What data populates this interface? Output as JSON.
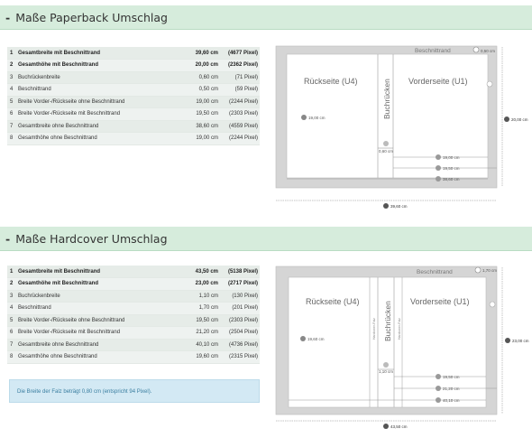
{
  "paperback": {
    "title": "Maße Paperback Umschlag",
    "rows": [
      {
        "n": "1",
        "label": "Gesamtbreite mit Beschnittrand",
        "cm": "39,60 cm",
        "px": "(4677 Pixel)",
        "bold": true
      },
      {
        "n": "2",
        "label": "Gesamthöhe mit Beschnittrand",
        "cm": "20,00 cm",
        "px": "(2362 Pixel)",
        "bold": true
      },
      {
        "n": "3",
        "label": "Buchrückenbreite",
        "cm": "0,60 cm",
        "px": "(71 Pixel)"
      },
      {
        "n": "4",
        "label": "Beschnittrand",
        "cm": "0,50 cm",
        "px": "(59 Pixel)"
      },
      {
        "n": "5",
        "label": "Breite Vorder-/Rückseite ohne Beschnittrand",
        "cm": "19,00 cm",
        "px": "(2244 Pixel)"
      },
      {
        "n": "6",
        "label": "Breite Vorder-/Rückseite mit Beschnittrand",
        "cm": "19,50 cm",
        "px": "(2303 Pixel)"
      },
      {
        "n": "7",
        "label": "Gesamtbreite ohne Beschnittrand",
        "cm": "38,60 cm",
        "px": "(4559 Pixel)"
      },
      {
        "n": "8",
        "label": "Gesamthöhe ohne Beschnittrand",
        "cm": "19,00 cm",
        "px": "(2244 Pixel)"
      }
    ],
    "diagram": {
      "bleed_label": "Beschnittrand",
      "back": "Rückseite (U4)",
      "spine": "Buchrücken",
      "front": "Vorderseite (U1)",
      "bleed_dim": "0,50 cm",
      "height_dim": "20,00 cm",
      "back_height": "19,00 cm",
      "spine_dim": "0,60 cm",
      "front_width": "19,00 cm",
      "front_width_bleed": "19,50 cm",
      "total_no_bleed": "38,60 cm",
      "total_width": "39,60 cm"
    }
  },
  "hardcover": {
    "title": "Maße Hardcover Umschlag",
    "rows": [
      {
        "n": "1",
        "label": "Gesamtbreite mit Beschnittrand",
        "cm": "43,50 cm",
        "px": "(5138 Pixel)",
        "bold": true
      },
      {
        "n": "2",
        "label": "Gesamthöhe mit Beschnittrand",
        "cm": "23,00 cm",
        "px": "(2717 Pixel)",
        "bold": true
      },
      {
        "n": "3",
        "label": "Buchrückenbreite",
        "cm": "1,10 cm",
        "px": "(130 Pixel)"
      },
      {
        "n": "4",
        "label": "Beschnittrand",
        "cm": "1,70 cm",
        "px": "(201 Pixel)"
      },
      {
        "n": "5",
        "label": "Breite Vorder-/Rückseite ohne Beschnittrand",
        "cm": "19,50 cm",
        "px": "(2303 Pixel)"
      },
      {
        "n": "6",
        "label": "Breite Vorder-/Rückseite mit Beschnittrand",
        "cm": "21,20 cm",
        "px": "(2504 Pixel)"
      },
      {
        "n": "7",
        "label": "Gesamtbreite ohne Beschnittrand",
        "cm": "40,10 cm",
        "px": "(4736 Pixel)"
      },
      {
        "n": "8",
        "label": "Gesamthöhe ohne Beschnittrand",
        "cm": "19,60 cm",
        "px": "(2315 Pixel)"
      }
    ],
    "note": "Die Breite der Falz beträgt 0,80 cm (entspricht 94 Pixel).",
    "diagram": {
      "bleed_label": "Beschnittrand",
      "back": "Rückseite (U4)",
      "spine": "Buchrücken",
      "front": "Vorderseite (U1)",
      "fold": "Hardcover-Falz",
      "bleed_dim": "1,70 cm",
      "height_dim": "23,00 cm",
      "back_height": "19,60 cm",
      "spine_dim": "1,10 cm",
      "front_width": "19,50 cm",
      "front_width_bleed": "21,20 cm",
      "total_no_bleed": "40,10 cm",
      "total_width": "43,50 cm"
    }
  }
}
